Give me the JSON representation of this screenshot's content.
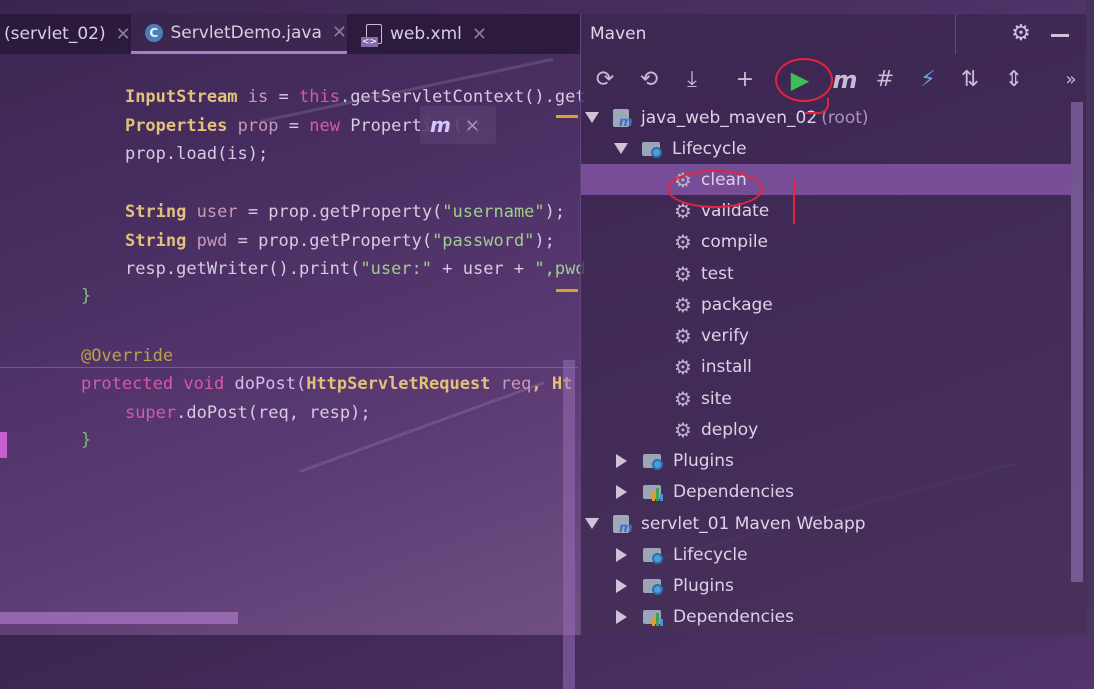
{
  "tabs": [
    {
      "label": "(servlet_02)",
      "icon": "none"
    },
    {
      "label": "ServletDemo.java",
      "icon": "java-class-icon"
    },
    {
      "label": "web.xml",
      "icon": "xml-file-icon"
    }
  ],
  "code": {
    "l1": {
      "type": "InputStream",
      "var": "is",
      "eq": " = ",
      "kw": "this",
      "rest": ".getServletContext().get"
    },
    "l2": {
      "type": "Properties",
      "var": "prop",
      "eq": " = ",
      "kw": "new",
      "rest": " Properties();"
    },
    "l3": {
      "text": "prop.load(is);"
    },
    "l4": {
      "type": "String",
      "var": "user",
      "eq": " = ",
      "m": "prop.getProperty(",
      "str": "\"username\"",
      "end": ");"
    },
    "l5": {
      "type": "String",
      "var": "pwd",
      "eq": " = ",
      "m": "prop.getProperty(",
      "str": "\"password\"",
      "end": ");"
    },
    "l6": {
      "m": "resp.getWriter().print(",
      "str1": "\"user:\"",
      "mid": " + user + ",
      "str2": "\",pwd"
    },
    "l7": {
      "text": "}"
    },
    "l8": {
      "text": "@Override"
    },
    "l9": {
      "kw": "protected",
      "kw2": "void",
      "m": "doPost(",
      "type": "HttpServletRequest",
      "var": "req",
      "rest": ", Ht"
    },
    "l10": {
      "kw": "super",
      "rest": ".doPost(req, resp);"
    },
    "l11": {
      "text": "}"
    }
  },
  "maven_popup": {
    "icon": "maven-reload-icon",
    "close": "×"
  },
  "maven": {
    "title": "Maven",
    "toolbar": [
      {
        "name": "reload-icon",
        "glyph": "⟳"
      },
      {
        "name": "generate-sources-icon",
        "glyph": "⤓"
      },
      {
        "name": "download-icon",
        "glyph": "⤓"
      },
      {
        "name": "add-icon",
        "glyph": "+"
      },
      {
        "name": "run-icon",
        "glyph": "▶"
      },
      {
        "name": "maven-goal-icon",
        "glyph": "m"
      },
      {
        "name": "skip-tests-icon",
        "glyph": "#"
      },
      {
        "name": "offline-icon",
        "glyph": "⚡"
      },
      {
        "name": "show-dependencies-icon",
        "glyph": "⇅"
      },
      {
        "name": "collapse-all-icon",
        "glyph": "⇕"
      },
      {
        "name": "more-icon",
        "glyph": "»"
      }
    ],
    "tree": [
      {
        "label": "java_web_maven_02",
        "suffix": "(root)",
        "kind": "project",
        "expanded": true
      },
      {
        "label": "Lifecycle",
        "kind": "folder",
        "expanded": true
      },
      {
        "label": "clean",
        "kind": "goal",
        "selected": true
      },
      {
        "label": "validate",
        "kind": "goal"
      },
      {
        "label": "compile",
        "kind": "goal"
      },
      {
        "label": "test",
        "kind": "goal"
      },
      {
        "label": "package",
        "kind": "goal"
      },
      {
        "label": "verify",
        "kind": "goal"
      },
      {
        "label": "install",
        "kind": "goal"
      },
      {
        "label": "site",
        "kind": "goal"
      },
      {
        "label": "deploy",
        "kind": "goal"
      },
      {
        "label": "Plugins",
        "kind": "folder",
        "expanded": false
      },
      {
        "label": "Dependencies",
        "kind": "deps",
        "expanded": false
      },
      {
        "label": "servlet_01 Maven Webapp",
        "kind": "project",
        "expanded": true
      },
      {
        "label": "Lifecycle",
        "kind": "folder",
        "expanded": false
      },
      {
        "label": "Plugins",
        "kind": "folder",
        "expanded": false
      },
      {
        "label": "Dependencies",
        "kind": "deps",
        "expanded": false
      }
    ]
  },
  "colors": {
    "accent": "#b07acc",
    "run": "#3fbf5a",
    "annotation": "#e5233b"
  }
}
